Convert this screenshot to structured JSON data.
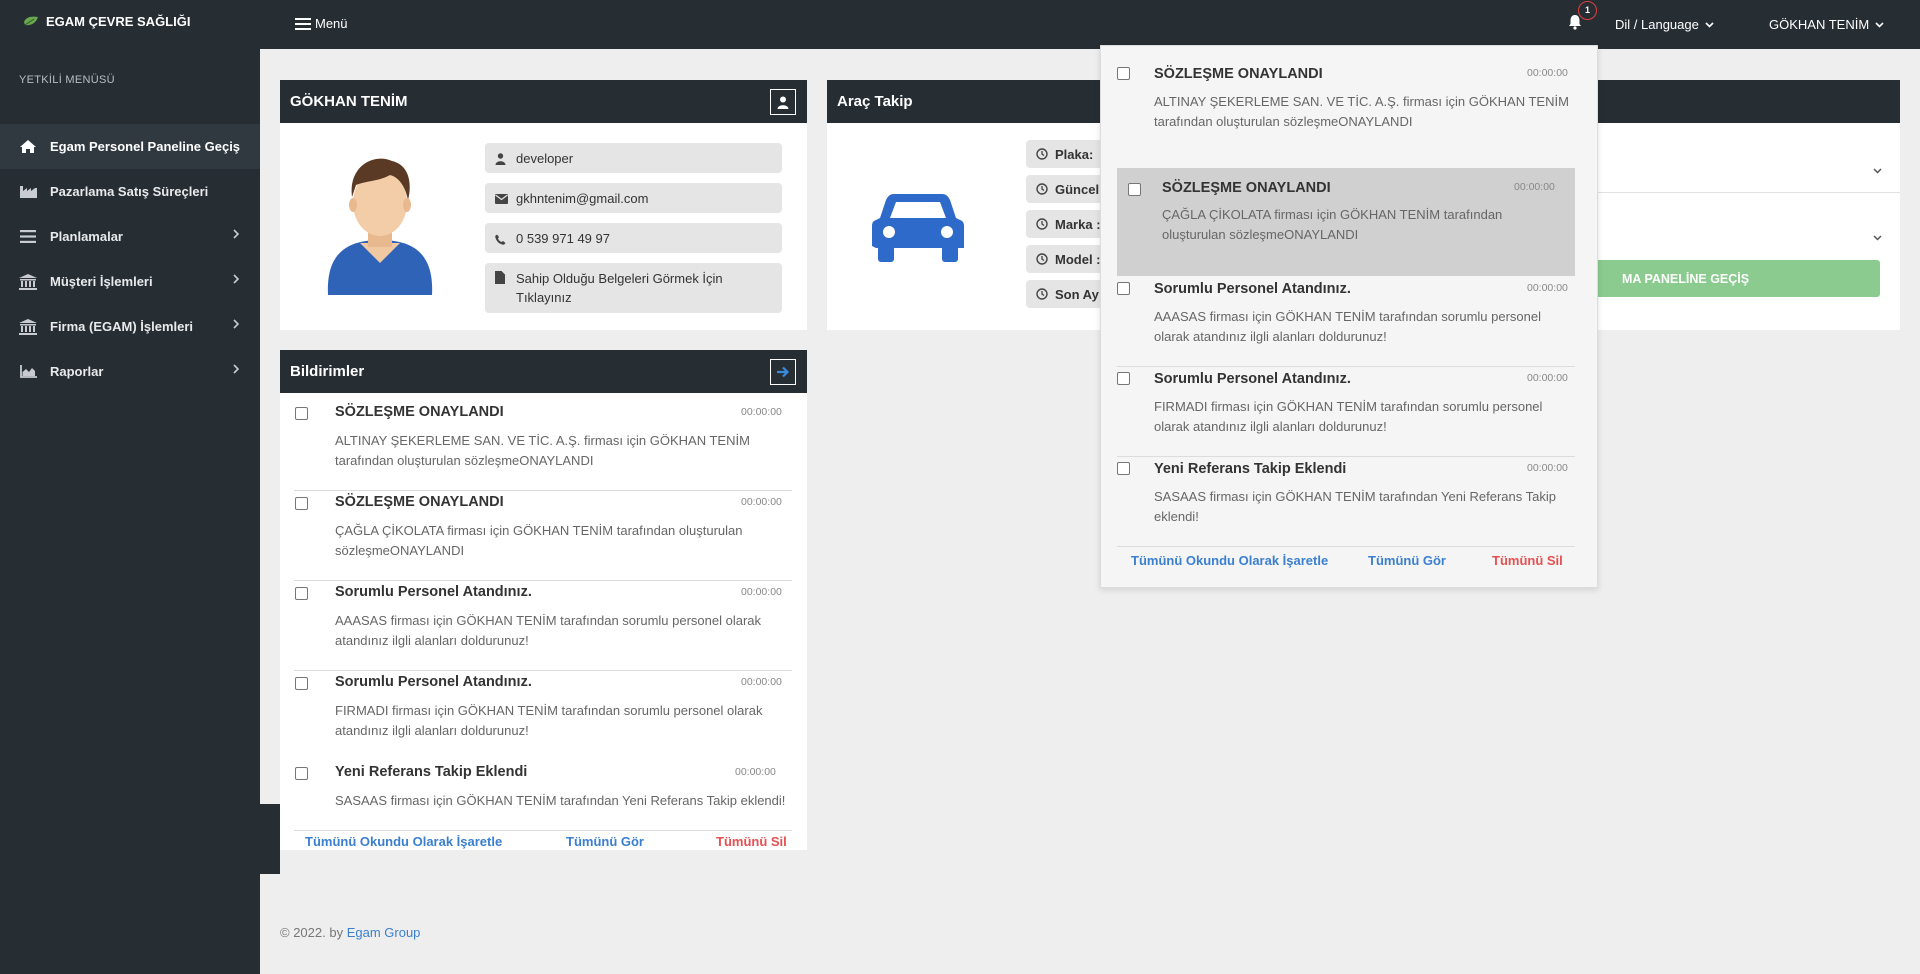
{
  "app": {
    "title": "EGAM ÇEVRE SAĞLIĞI",
    "menu_label": "Menü",
    "notification_count": "1",
    "language_label": "Dil / Language",
    "user_name": "GÖKHAN TENİM"
  },
  "sidebar": {
    "title": "YETKİLİ MENÜSÜ",
    "items": [
      {
        "label": "Egam Personel Paneline Geçiş",
        "icon": "home-icon",
        "active": true
      },
      {
        "label": "Pazarlama Satış Süreçleri",
        "icon": "factory-icon"
      },
      {
        "label": "Planlamalar",
        "icon": "list-icon"
      },
      {
        "label": "Müşteri İşlemleri",
        "icon": "bank-icon"
      },
      {
        "label": "Firma (EGAM) İşlemleri",
        "icon": "bank-icon"
      },
      {
        "label": "Raporlar",
        "icon": "chart-area-icon"
      }
    ]
  },
  "profile": {
    "title": "GÖKHAN TENİM",
    "username": "developer",
    "email": "gkhntenim@gmail.com",
    "phone": "0 539 971 49 97",
    "documents_link": "Sahip Olduğu Belgeleri Görmek İçin Tıklayınız"
  },
  "vehicle": {
    "title": "Araç Takip",
    "rows": [
      "Plaka:",
      "Güncel",
      "Marka :",
      "Model :",
      "Son Ay"
    ]
  },
  "notifications": {
    "title": "Bildirimler",
    "items": [
      {
        "title": "SÖZLEŞME ONAYLANDI",
        "time": "00:00:00",
        "body": "ALTINAY ŞEKERLEME SAN. VE TİC. A.Ş. firması için GÖKHAN TENİM tarafından oluşturulan sözleşmeONAYLANDI"
      },
      {
        "title": "SÖZLEŞME ONAYLANDI",
        "time": "00:00:00",
        "body": "ÇAĞLA ÇİKOLATA firması için GÖKHAN TENİM tarafından oluşturulan sözleşmeONAYLANDI"
      },
      {
        "title": "Sorumlu Personel Atandınız.",
        "time": "00:00:00",
        "body": "AAASAS firması için GÖKHAN TENİM tarafından sorumlu personel olarak atandınız ilgli alanları doldurunuz!"
      },
      {
        "title": "Sorumlu Personel Atandınız.",
        "time": "00:00:00",
        "body": "FIRMADI firması için GÖKHAN TENİM tarafından sorumlu personel olarak atandınız ilgli alanları doldurunuz!"
      },
      {
        "title": "Yeni Referans Takip Eklendi",
        "time": "00:00:00",
        "body": "SASAAS firması için GÖKHAN TENİM tarafından Yeni Referans Takip eklendi!"
      }
    ],
    "mark_all_read": "Tümünü Okundu Olarak İşaretle",
    "see_all": "Tümünü Gör",
    "delete_all": "Tümünü Sil"
  },
  "right_card": {
    "button_label": "MA PANELİNE GEÇİŞ"
  },
  "footer": {
    "text": "© 2022. by",
    "link": "Egam Group"
  }
}
